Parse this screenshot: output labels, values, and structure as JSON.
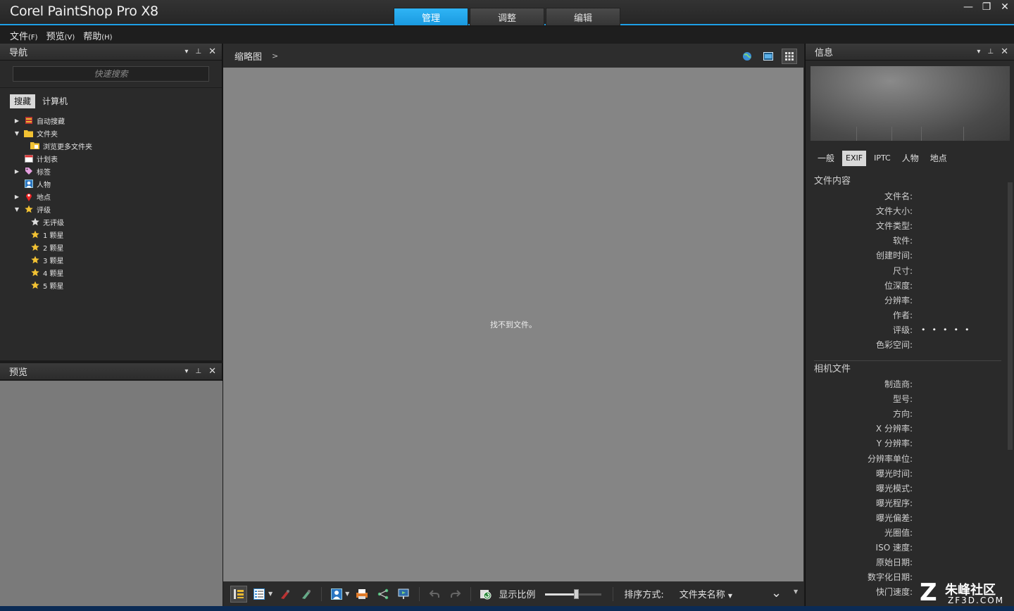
{
  "app": {
    "title": "Corel PaintShop Pro X8",
    "tabs": [
      "管理",
      "调整",
      "编辑"
    ],
    "window_controls": [
      "—",
      "❐",
      "✕"
    ]
  },
  "menu": {
    "items": [
      {
        "label": "文件",
        "key": "(F)"
      },
      {
        "label": "预览",
        "key": "(V)"
      },
      {
        "label": "帮助",
        "key": "(H)"
      }
    ]
  },
  "nav": {
    "title": "导航",
    "search_placeholder": "快速搜索",
    "tabs": [
      "搜藏",
      "计算机"
    ],
    "tree": [
      {
        "label": "自动搜藏",
        "icon": "collection-icon",
        "arrow": "▶",
        "level": 0
      },
      {
        "label": "文件夹",
        "icon": "folder-icon",
        "arrow": "▼",
        "level": 0
      },
      {
        "label": "浏览更多文件夹",
        "icon": "folder-add-icon",
        "arrow": "",
        "level": 1
      },
      {
        "label": "计划表",
        "icon": "calendar-icon",
        "arrow": "",
        "level": 0
      },
      {
        "label": "标签",
        "icon": "tag-icon",
        "arrow": "▶",
        "level": 0
      },
      {
        "label": "人物",
        "icon": "person-icon",
        "arrow": "",
        "level": 0
      },
      {
        "label": "地点",
        "icon": "pin-icon",
        "arrow": "▶",
        "level": 0
      },
      {
        "label": "评级",
        "icon": "star-icon",
        "arrow": "▼",
        "level": 0
      },
      {
        "label": "无评级",
        "icon": "star-outline-icon",
        "arrow": "",
        "level": 1
      },
      {
        "label": "1 颗星",
        "icon": "star-icon",
        "arrow": "",
        "level": 1
      },
      {
        "label": "2 颗星",
        "icon": "star-icon",
        "arrow": "",
        "level": 1
      },
      {
        "label": "3 颗星",
        "icon": "star-icon",
        "arrow": "",
        "level": 1
      },
      {
        "label": "4 颗星",
        "icon": "star-icon",
        "arrow": "",
        "level": 1
      },
      {
        "label": "5 颗星",
        "icon": "star-icon",
        "arrow": "",
        "level": 1
      }
    ]
  },
  "preview": {
    "title": "预览"
  },
  "main": {
    "breadcrumb": "缩略图",
    "breadcrumb_arrow": ">",
    "empty_message": "找不到文件。",
    "zoom_label": "显示比例",
    "zoom_level": 0.55,
    "sort_label": "排序方式:",
    "sort_value": "文件夹名称"
  },
  "info": {
    "title": "信息",
    "tabs": [
      "一般",
      "EXIF",
      "IPTC",
      "人物",
      "地点"
    ],
    "active_tab": "EXIF",
    "section1": {
      "title": "文件内容",
      "fields": [
        "文件名:",
        "文件大小:",
        "文件类型:",
        "软件:",
        "创建时间:",
        "尺寸:",
        "位深度:",
        "分辨率:",
        "作者:",
        "评级:",
        "色彩空间:"
      ],
      "rating_value": "•••••"
    },
    "section2": {
      "title": "相机文件",
      "fields": [
        "制造商:",
        "型号:",
        "方向:",
        "X 分辨率:",
        "Y 分辨率:",
        "分辨率单位:",
        "曝光时间:",
        "曝光模式:",
        "曝光程序:",
        "曝光偏差:",
        "光圈值:",
        "ISO 速度:",
        "原始日期:",
        "数字化日期:",
        "快门速度:"
      ]
    }
  },
  "watermark": {
    "brand": "朱峰社区",
    "url": "ZF3D.COM",
    "logo_letter": "Z"
  },
  "colors": {
    "accent": "#1e9fe6",
    "star": "#f2c233"
  }
}
